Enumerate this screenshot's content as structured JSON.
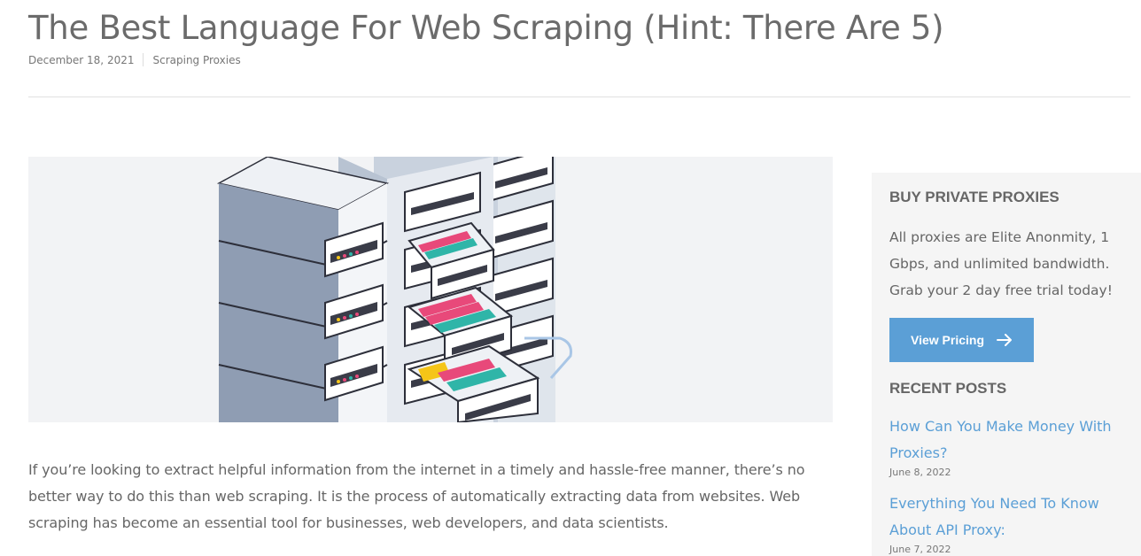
{
  "article": {
    "title": "The Best Language For Web Scraping (Hint: There Are 5)",
    "date": "December 18, 2021",
    "category": "Scraping Proxies",
    "intro": "If you’re looking to extract helpful information from the internet in a timely and hassle-free manner, there’s no better way to do this than web scraping. It is the process of automatically extracting data from websites. Web scraping has become an essential tool for businesses, web developers, and data scientists."
  },
  "sidebar": {
    "heading": "BUY PRIVATE PROXIES",
    "description": "All proxies are Elite Anonmity, 1 Gbps, and unlimited bandwidth. Grab your 2 day free trial today!",
    "button_label": "View Pricing",
    "recent_heading": "RECENT POSTS",
    "recent_posts": [
      {
        "title": "How Can You Make Money With Proxies?",
        "date": "June 8, 2022"
      },
      {
        "title": "Everything You Need To Know About API Proxy:",
        "date": "June 7, 2022"
      }
    ]
  },
  "colors": {
    "accent": "#5b9fd6",
    "server_body": "#8f9db3",
    "file_pink": "#e8497a",
    "file_teal": "#2fb5a8",
    "file_yellow": "#f5c518"
  },
  "icons": {
    "button_icon": "arrow-right-icon"
  }
}
